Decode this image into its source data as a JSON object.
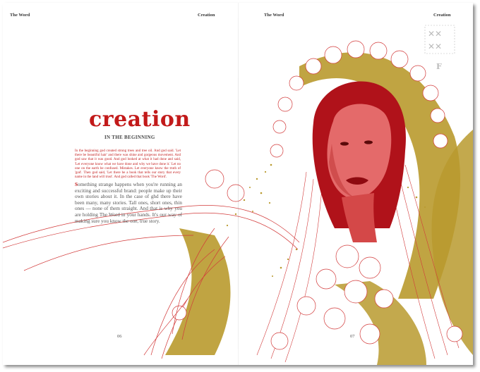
{
  "running_heads": {
    "left_a": "The Word",
    "left_b": "Creation",
    "right_a": "The Word",
    "right_b": "Creation"
  },
  "article": {
    "title": "creation",
    "subtitle": "IN THE BEGINNING",
    "intro": "In the beginning god created strong trees and tree oil. And god said. 'Let there be beautiful hair' and there was shine and gorgeous movement. And god saw that it was good. And god looked at what it had done and said, 'Let everyone know what we have done and why we have done it.' Let no one on the earth be confused. Mistakes. Let everyone know the truth of 'god'. Then god said, 'Let there be a book that tells our story that every name in the land will trust'. And god called that book 'The Word'.",
    "body_dropcap": "S",
    "body": "omething strange happens when you're running an exciting and successful brand: people make up their own stories about it. In the case of ghd there have been many, many stories. Tall ones, short ones, thin ones — none of them straight. And that is why you are holding The Word in your hands. It's our way of making sure you know the one, true story."
  },
  "folios": {
    "left": "06",
    "right": "07"
  },
  "corner_mark": {
    "letter": "F"
  },
  "colors": {
    "accent_red": "#c21a1a",
    "gold": "#b99a2e",
    "line_red": "#d23a3a"
  }
}
